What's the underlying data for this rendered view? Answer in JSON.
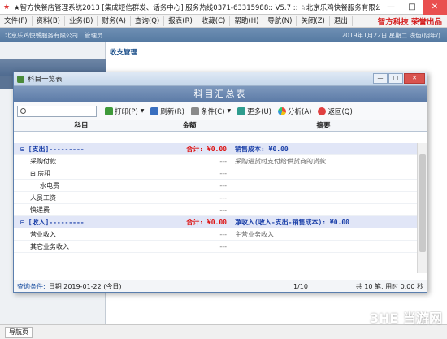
{
  "window": {
    "title": "★智方快餐店管理系统2013 [集成短信群发、话务中心] 服务热线0371-63315988:: V5.7 :: ☆北京乐鸡快餐服务有限公司",
    "minimize": "—",
    "maximize": "□",
    "close": "✕"
  },
  "menu": {
    "items": [
      "文件(F)",
      "资料(B)",
      "业务(B)",
      "财务(A)",
      "查询(Q)",
      "报表(R)",
      "收藏(C)",
      "帮助(H)",
      "导航(N)",
      "关闭(Z)",
      "退出"
    ],
    "brand": "智方科技 荣誉出品"
  },
  "infobar": {
    "company": "北京乐鸡快餐服务有限公司",
    "user": "管理员",
    "datetime": "2019年1月22日  星期二  浅色(阴年/)"
  },
  "main": {
    "section_title": "收支管理"
  },
  "dialog": {
    "title": "科目一览表",
    "banner": "科目汇总表",
    "toolbar": {
      "print": "打印(P)",
      "refresh": "刷新(R)",
      "condition": "条件(C)",
      "more": "更多(U)",
      "analysis": "分析(A)",
      "back": "返回(Q)"
    },
    "columns": [
      "科目",
      "金额",
      "摘要"
    ],
    "rows": [
      {
        "kind": "group",
        "c1": "⊟ [支出]---------",
        "c2": "合计: ¥0.00",
        "c3": "销售成本: ¥0.00"
      },
      {
        "kind": "item",
        "c1": "采购付款",
        "c2": "---",
        "c3": "采购进货时支付给供货商的货款",
        "indent": 1
      },
      {
        "kind": "item",
        "c1": "⊟ 房租",
        "c2": "---",
        "c3": "",
        "indent": 1
      },
      {
        "kind": "item",
        "c1": "水电费",
        "c2": "---",
        "c3": "",
        "indent": 2
      },
      {
        "kind": "item",
        "c1": "人员工资",
        "c2": "---",
        "c3": "",
        "indent": 1
      },
      {
        "kind": "item",
        "c1": "快递费",
        "c2": "---",
        "c3": "",
        "indent": 1
      },
      {
        "kind": "group",
        "c1": "⊟ [收入]---------",
        "c2": "合计: ¥0.00",
        "c3": "净收入(收入-支出-销售成本): ¥0.00"
      },
      {
        "kind": "item",
        "c1": "营业收入",
        "c2": "---",
        "c3": "主营业务收入",
        "indent": 1
      },
      {
        "kind": "item",
        "c1": "其它业务收入",
        "c2": "---",
        "c3": "",
        "indent": 1
      }
    ],
    "footer": {
      "query_label": "查询条件:",
      "query_value": "日期 2019-01-22 (今日)",
      "page": "1/10",
      "summary": "共 10 笔, 用时 0.00 秒"
    }
  },
  "statusbar": {
    "tab": "导航页",
    "watermark": "3HE 当游网"
  }
}
